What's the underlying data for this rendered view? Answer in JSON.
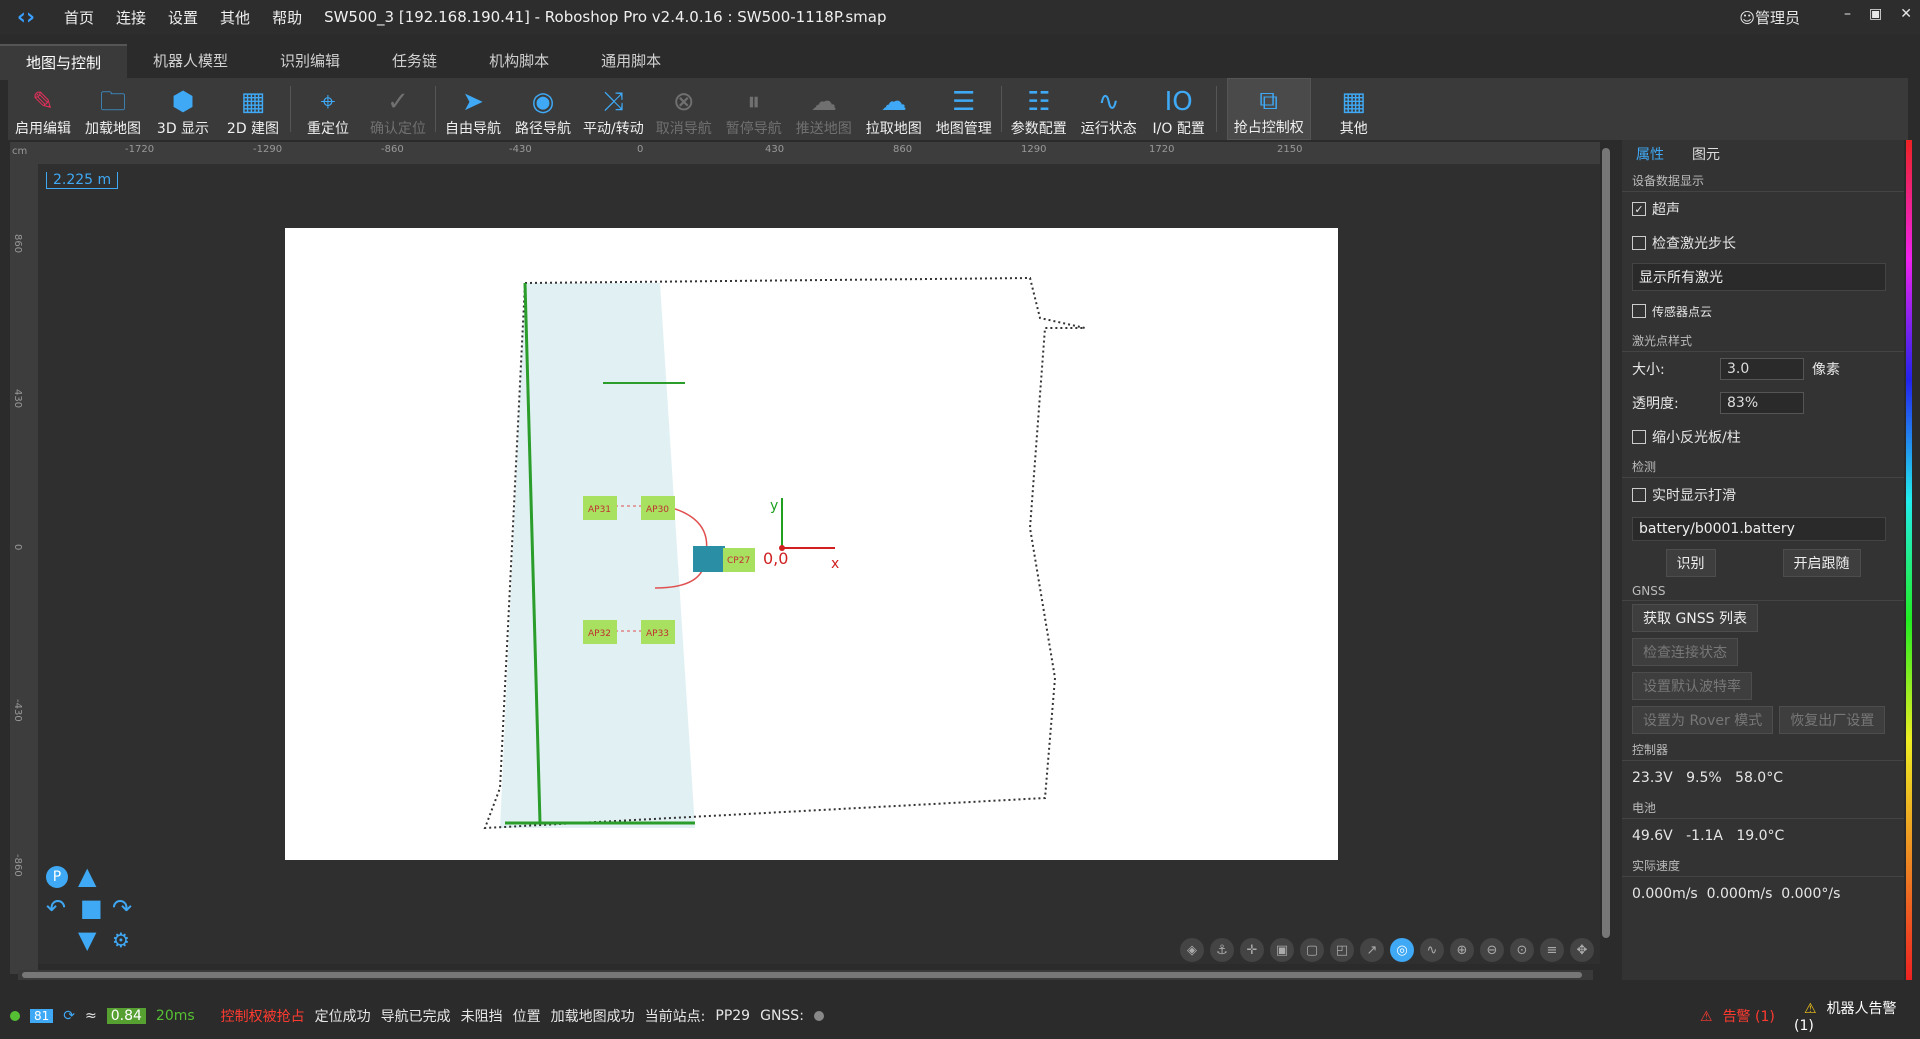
{
  "app": {
    "title": "SW500_3 [192.168.190.41] - Roboshop Pro v2.4.0.16 : SW500-1118P.smap",
    "user": "管理员",
    "menu": [
      "首页",
      "连接",
      "设置",
      "其他",
      "帮助"
    ]
  },
  "tabs": [
    "地图与控制",
    "机器人模型",
    "识别编辑",
    "任务链",
    "机构脚本",
    "通用脚本"
  ],
  "toolbar": [
    {
      "label": "启用编辑",
      "icon": "pen-icon",
      "enabled": true
    },
    {
      "label": "加载地图",
      "icon": "folder-icon",
      "enabled": true
    },
    {
      "label": "3D 显示",
      "icon": "cube-icon",
      "enabled": true
    },
    {
      "label": "2D 建图",
      "icon": "map-icon",
      "enabled": true
    },
    {
      "label": "重定位",
      "icon": "crosshair-icon",
      "enabled": true
    },
    {
      "label": "确认定位",
      "icon": "check-circle-icon",
      "enabled": false
    },
    {
      "label": "自由导航",
      "icon": "navigate-arrow-icon",
      "enabled": true
    },
    {
      "label": "路径导航",
      "icon": "location-pin-icon",
      "enabled": true
    },
    {
      "label": "平动/转动",
      "icon": "move-icon",
      "enabled": true
    },
    {
      "label": "取消导航",
      "icon": "cancel-icon",
      "enabled": false
    },
    {
      "label": "暂停导航",
      "icon": "pause-icon",
      "enabled": false
    },
    {
      "label": "推送地图",
      "icon": "cloud-upload-icon",
      "enabled": false
    },
    {
      "label": "拉取地图",
      "icon": "cloud-download-icon",
      "enabled": true
    },
    {
      "label": "地图管理",
      "icon": "layers-icon",
      "enabled": true
    },
    {
      "label": "参数配置",
      "icon": "config-icon",
      "enabled": true
    },
    {
      "label": "运行状态",
      "icon": "monitor-icon",
      "enabled": true
    },
    {
      "label": "I/O 配置",
      "icon": "io-icon",
      "enabled": true
    },
    {
      "label": "抢占控制权",
      "icon": "control-icon",
      "enabled": true
    },
    {
      "label": "其他",
      "icon": "grid-icon",
      "enabled": true
    }
  ],
  "ruler": {
    "unit": "cm",
    "top_ticks": [
      "-1720",
      "-1290",
      "-860",
      "-430",
      "0",
      "430",
      "860",
      "1290",
      "1720",
      "2150"
    ],
    "left_ticks": [
      "860",
      "430",
      "0",
      "-430",
      "-860"
    ]
  },
  "scale_label": "2.225 m",
  "map": {
    "stations": [
      "AP31",
      "AP30",
      "CP27",
      "AP32",
      "AP33"
    ],
    "origin_label": "0,0",
    "axis_x": "x",
    "axis_y": "y"
  },
  "panel": {
    "tabs": [
      "属性",
      "图元"
    ],
    "device_section": "设备数据显示",
    "ultrasonic": {
      "label": "超声",
      "checked": true
    },
    "laser_step": {
      "label": "检查激光步长",
      "checked": false
    },
    "laser_mode": "显示所有激光",
    "sensor_cloud": {
      "label": "传感器点云",
      "checked": false
    },
    "laser_style_section": "激光点样式",
    "size_label": "大小:",
    "size_value": "3.0",
    "size_unit": "像素",
    "opacity_label": "透明度:",
    "opacity_value": "83%",
    "shrink_reflector": {
      "label": "缩小反光板/柱",
      "checked": false
    },
    "detect_section": "检测",
    "realtime_smooth": {
      "label": "实时显示打滑",
      "checked": false
    },
    "battery_file": "battery/b0001.battery",
    "identify_btn": "识别",
    "follow_btn": "开启跟随",
    "gnss_section": "GNSS",
    "gnss_list_btn": "获取 GNSS 列表",
    "check_conn_btn": "检查连接状态",
    "baud_btn": "设置默认波特率",
    "rover_btn": "设置为 Rover 模式",
    "factory_btn": "恢复出厂设置",
    "controller_section": "控制器",
    "controller": [
      "23.3V",
      "9.5%",
      "58.0°C"
    ],
    "battery_section": "电池",
    "battery": [
      "49.6V",
      "-1.1A",
      "19.0°C"
    ],
    "speed_section": "实际速度",
    "speed": [
      "0.000m/s",
      "0.000m/s",
      "0.000°/s"
    ]
  },
  "status": {
    "battery_badge": "81",
    "signal_value": "0.84",
    "latency": "20ms",
    "control_taken": "控制权被抢占",
    "loc": "定位成功",
    "nav": "导航已完成",
    "block": "未阻挡",
    "pos": "位置",
    "map_loaded": "加载地图成功",
    "station_label": "当前站点:",
    "station": "PP29",
    "gnss": "GNSS:",
    "alarm": "告警 (1)",
    "robot_alarm": "机器人告警 (1)"
  },
  "colors": {
    "accent": "#3fa9f5",
    "warn": "#ff3b30"
  }
}
